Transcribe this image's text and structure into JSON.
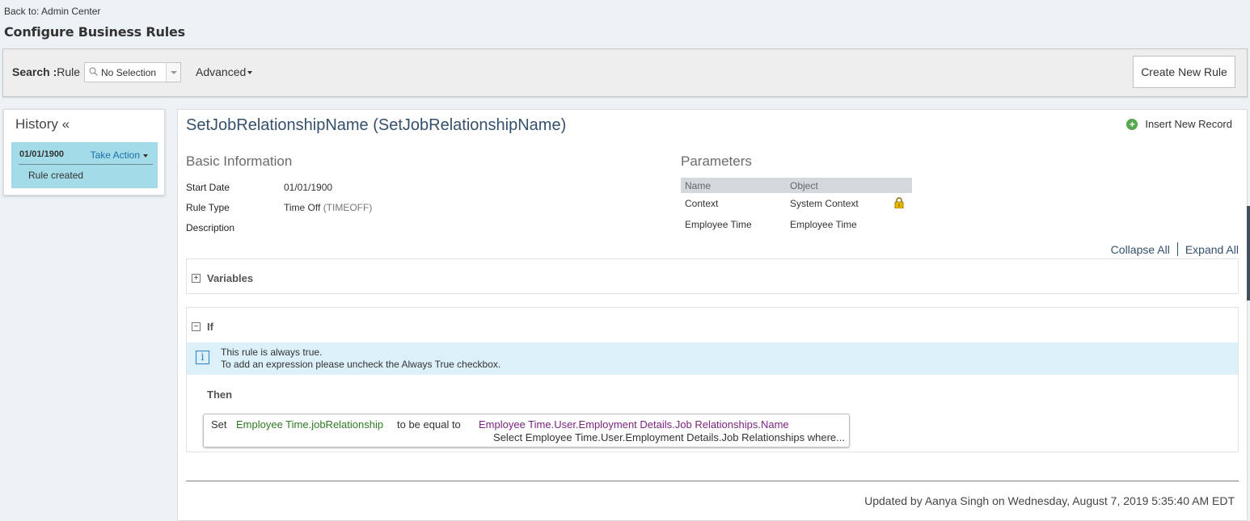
{
  "header": {
    "back_link": "Back to: Admin Center",
    "title": "Configure Business Rules"
  },
  "search": {
    "label_bold": "Search :",
    "label_suffix": "Rule",
    "select_value": "No Selection",
    "advanced": "Advanced",
    "create_button": "Create New Rule"
  },
  "history": {
    "title": "History «",
    "entries": [
      {
        "date": "01/01/1900",
        "action": "Take Action",
        "note": "Rule created"
      }
    ]
  },
  "rule": {
    "title": "SetJobRelationshipName (SetJobRelationshipName)",
    "insert_record": "Insert New Record",
    "basic_info_heading": "Basic Information",
    "start_date_label": "Start Date",
    "start_date_value": "01/01/1900",
    "rule_type_label": "Rule Type",
    "rule_type_value": "Time Off",
    "rule_type_code": "(TIMEOFF)",
    "description_label": "Description",
    "parameters_heading": "Parameters",
    "parameters": {
      "columns": [
        "Name",
        "Object"
      ],
      "rows": [
        {
          "name": "Context",
          "object": "System Context",
          "locked": true
        },
        {
          "name": "Employee Time",
          "object": "Employee Time",
          "locked": false
        }
      ]
    },
    "collapse_all": "Collapse All",
    "expand_all": "Expand All",
    "variables_label": "Variables",
    "variables_toggle": "+",
    "if_label": "If",
    "if_toggle": "−",
    "info_line1": "This rule is always true.",
    "info_line2": "To add an expression please uncheck the Always True checkbox.",
    "then_label": "Then",
    "expression": {
      "set": "Set",
      "field": "Employee Time.jobRelationship",
      "operator": "to be equal to",
      "value": "Employee Time.User.Employment Details.Job Relationships.Name",
      "select": "Select Employee Time.User.Employment Details.Job Relationships where..."
    },
    "footer": "Updated by Aanya Singh on Wednesday, August 7, 2019 5:35:40 AM EDT"
  },
  "colors": {
    "history_highlight": "#a3dce8",
    "title_blue": "#34506b",
    "field_green": "#2e7a23",
    "value_purple": "#7a2381",
    "info_strip": "#dcf0fa"
  }
}
